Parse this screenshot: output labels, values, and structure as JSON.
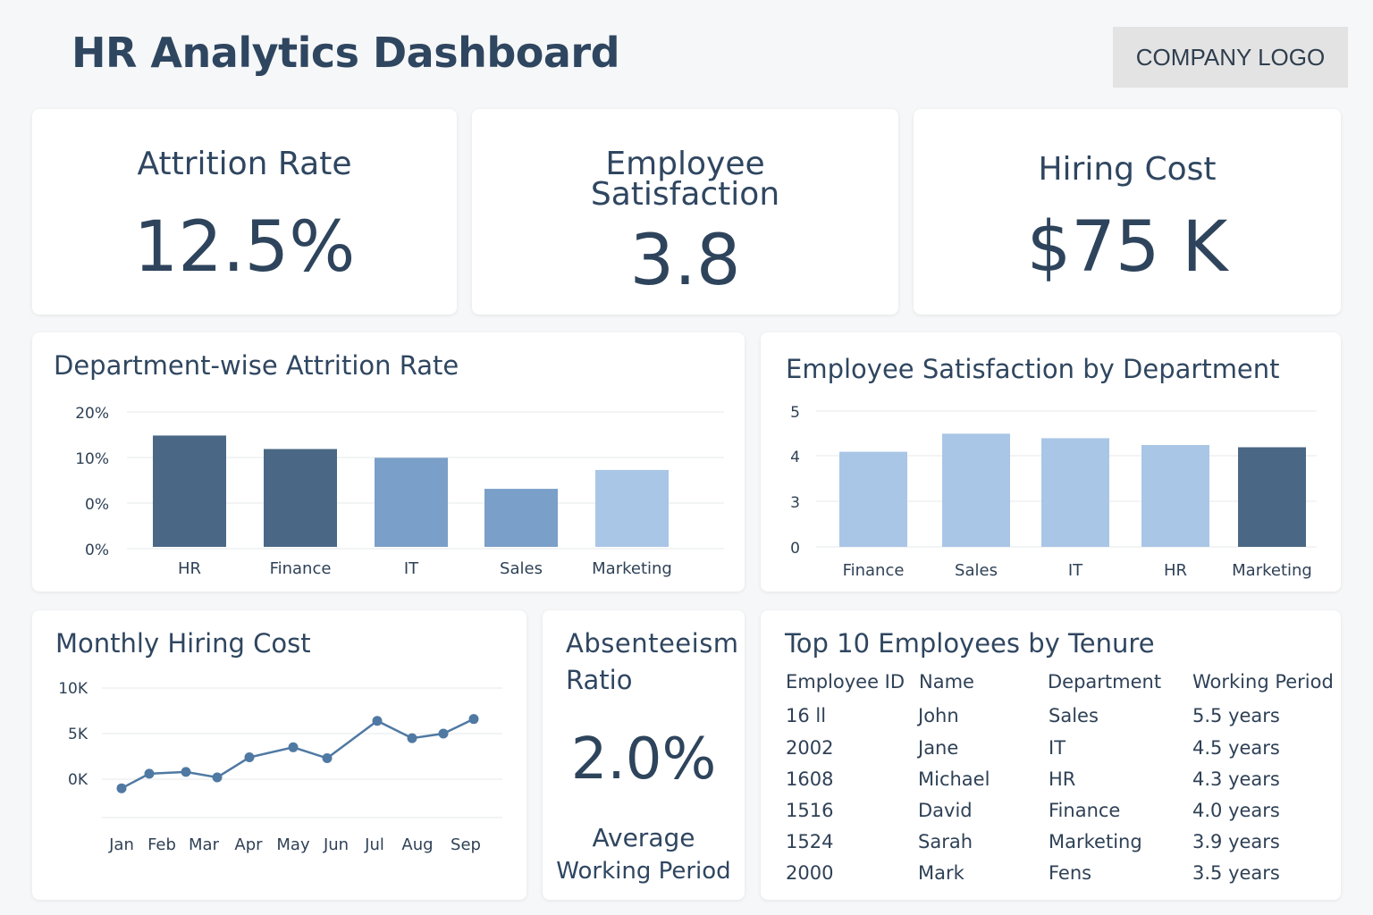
{
  "header": {
    "title": "HR Analytics Dashboard",
    "logo_text": "COMPANY LOGO"
  },
  "kpis": [
    {
      "title": "Attrition Rate",
      "value": "12.5%"
    },
    {
      "title_line1": "Employee",
      "title_line2": "Satisfaction",
      "value": "3.8"
    },
    {
      "title": "Hiring Cost",
      "value": "$75 K"
    }
  ],
  "attrition_chart": {
    "title": "Department-wise Attrition Rate",
    "chart_data": {
      "type": "bar",
      "categories": [
        "HR",
        "Finance",
        "IT",
        "Sales",
        "Marketing"
      ],
      "values": [
        16.5,
        14.5,
        13.2,
        8.6,
        11.4
      ],
      "ytick_labels": [
        "20%",
        "10%",
        "0%",
        "0%"
      ],
      "colors": [
        "#4a6885",
        "#4a6885",
        "#7a9fc8",
        "#7a9fc8",
        "#a9c6e6"
      ],
      "ylim": [
        0,
        20
      ]
    }
  },
  "satisfaction_chart": {
    "title": "Employee Satisfaction by Department",
    "chart_data": {
      "type": "bar",
      "categories": [
        "Finance",
        "Sales",
        "IT",
        "HR",
        "Marketing"
      ],
      "values": [
        4.1,
        4.5,
        4.4,
        4.25,
        4.2
      ],
      "ytick_labels": [
        "5",
        "4",
        "3",
        "0"
      ],
      "colors": [
        "#a9c6e6",
        "#a9c6e6",
        "#a9c6e6",
        "#a9c6e6",
        "#4a6885"
      ],
      "ylim": [
        2,
        5
      ]
    }
  },
  "hiring_chart": {
    "title": "Monthly Hiring Cost",
    "chart_data": {
      "type": "line",
      "categories": [
        "Jan",
        "Feb",
        "Mar",
        "Apr",
        "May",
        "Jun",
        "Jul",
        "Aug",
        "Sep"
      ],
      "points": [
        {
          "x": "Jan",
          "y": -1.0
        },
        {
          "x": "Feb",
          "y": 0.6
        },
        {
          "x": "Feb-Mar",
          "y": 0.8
        },
        {
          "x": "Mar",
          "y": 0.2
        },
        {
          "x": "Apr",
          "y": 2.4
        },
        {
          "x": "May",
          "y": 3.5
        },
        {
          "x": "Jun",
          "y": 2.3
        },
        {
          "x": "Jul",
          "y": 6.4
        },
        {
          "x": "Aug",
          "y": 4.5
        },
        {
          "x": "Aug-Sep",
          "y": 5.0
        },
        {
          "x": "Sep",
          "y": 6.6
        }
      ],
      "ytick_labels": [
        "10K",
        "5K",
        "0K"
      ],
      "ylim": [
        -2,
        10
      ],
      "color": "#4f79a3"
    }
  },
  "absenteeism": {
    "title_line1": "Absenteeism",
    "title_line2": "Ratio",
    "value": "2.0%",
    "sub_line1": "Average",
    "sub_line2": "Working Period"
  },
  "tenure_table": {
    "title": "Top 10 Employees by Tenure",
    "columns": [
      "Employee ID",
      "Name",
      "Department",
      "Working Period"
    ],
    "rows": [
      [
        "16 ll",
        "John",
        "Sales",
        "5.5 years"
      ],
      [
        "2002",
        "Jane",
        "IT",
        "4.5 years"
      ],
      [
        "1608",
        "Michael",
        "HR",
        "4.3 years"
      ],
      [
        "1516",
        "David",
        "Finance",
        "4.0 years"
      ],
      [
        "1524",
        "Sarah",
        "Marketing",
        "3.9 years"
      ],
      [
        "2000",
        "Mark",
        "Fens",
        "3.5 years"
      ]
    ]
  }
}
